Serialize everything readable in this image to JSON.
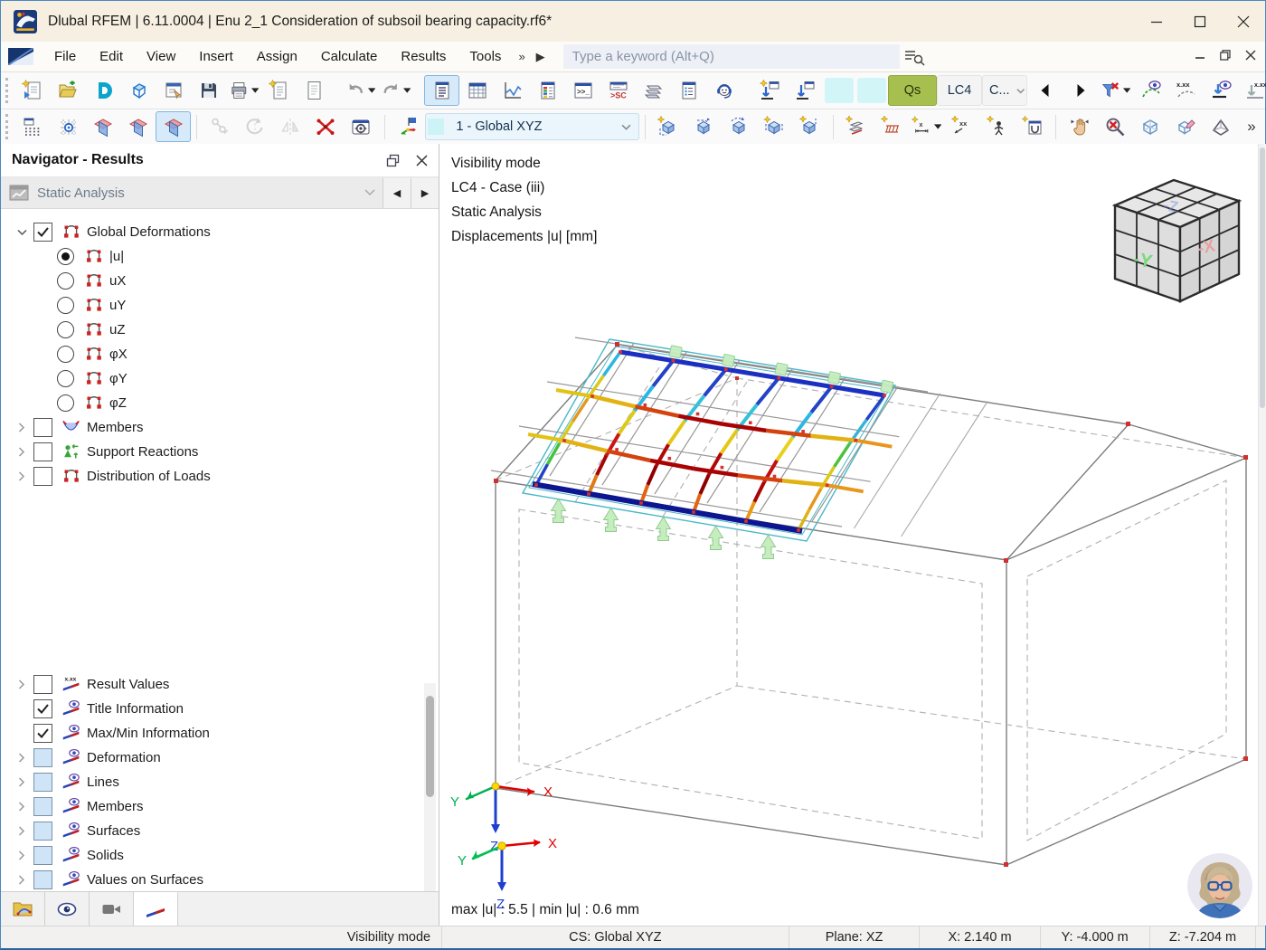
{
  "window": {
    "title": "Dlubal RFEM | 6.11.0004 | Enu 2_1 Consideration of subsoil bearing capacity.rf6*"
  },
  "menubar": {
    "items": [
      "File",
      "Edit",
      "View",
      "Insert",
      "Assign",
      "Calculate",
      "Results",
      "Tools"
    ],
    "overflow_chevrons": "»",
    "overflow_arrow": "▶",
    "search": {
      "placeholder": "Type a keyword (Alt+Q)"
    }
  },
  "toolbar_main": [
    {
      "type": "handle"
    },
    {
      "name": "new-model-button",
      "icon": "page-new"
    },
    {
      "name": "open-model-button",
      "icon": "folder-open"
    },
    {
      "name": "dlubal-center-button",
      "icon": "letter-d"
    },
    {
      "name": "model-3d-button",
      "icon": "cube-3d"
    },
    {
      "name": "edit-model-data-button",
      "icon": "form-edit"
    },
    {
      "name": "save-button",
      "icon": "save"
    },
    {
      "name": "print-button",
      "icon": "print",
      "caret": true
    },
    {
      "name": "new-printout-report-button",
      "icon": "page-star"
    },
    {
      "name": "printout-report-button",
      "icon": "page"
    },
    {
      "type": "sep"
    },
    {
      "name": "undo-button",
      "icon": "undo",
      "caret": true
    },
    {
      "name": "redo-button",
      "icon": "redo",
      "caret": true
    },
    {
      "type": "sep"
    },
    {
      "name": "navigator-toggle",
      "icon": "panel-navigator",
      "active": true
    },
    {
      "name": "tables-toggle",
      "icon": "table"
    },
    {
      "name": "result-diagrams-button",
      "icon": "diagram"
    },
    {
      "name": "color-panel-toggle",
      "icon": "panel-colors"
    },
    {
      "name": "console-button",
      "icon": "console"
    },
    {
      "name": "script-console-button",
      "icon": "console-sc"
    },
    {
      "name": "layers-button",
      "icon": "layers"
    },
    {
      "name": "lists-button",
      "icon": "panel-list"
    },
    {
      "name": "assistant-button",
      "icon": "assistant"
    },
    {
      "type": "sep"
    },
    {
      "name": "new-load-button",
      "icon": "load-new"
    },
    {
      "name": "show-loads-button",
      "icon": "load"
    },
    {
      "name": "load-swatch-1",
      "style": "swatch"
    },
    {
      "name": "load-swatch-2",
      "style": "swatch"
    },
    {
      "name": "load-type-button",
      "label": "Qs",
      "style": "qs"
    },
    {
      "name": "load-case-button",
      "label": "LC4",
      "style": "flat"
    },
    {
      "name": "case-combo",
      "label": "C...",
      "style": "flat",
      "caret": "chev"
    },
    {
      "name": "previous-case-button",
      "icon": "arrow-left"
    },
    {
      "name": "next-case-button",
      "icon": "arrow-right"
    },
    {
      "name": "filter-results-button",
      "icon": "filter-x",
      "caret": true
    },
    {
      "name": "show-results-toggle",
      "icon": "result-line-eye"
    },
    {
      "name": "result-values-toggle",
      "icon": "result-values"
    },
    {
      "name": "show-deformation-toggle",
      "icon": "result-arrow-eye"
    },
    {
      "name": "deformation-values-toggle",
      "icon": "result-arrow-values"
    },
    {
      "name": "render-solids-toggle",
      "icon": "solid-eye"
    },
    {
      "name": "toolbar-overflow-button",
      "label": "»",
      "style": "chev"
    }
  ],
  "toolbar_edit": [
    {
      "type": "handle"
    },
    {
      "name": "grid-button",
      "icon": "grid"
    },
    {
      "name": "snap-button",
      "icon": "snap"
    },
    {
      "name": "work-plane-xy-button",
      "icon": "plane"
    },
    {
      "name": "work-plane-xz-button",
      "icon": "plane"
    },
    {
      "name": "work-plane-yz-button",
      "icon": "plane",
      "active": true
    },
    {
      "type": "sep"
    },
    {
      "name": "select-objects-button",
      "icon": "move",
      "grayed": true
    },
    {
      "name": "rotate-objects-button",
      "icon": "rotate",
      "grayed": true
    },
    {
      "name": "mirror-objects-button",
      "icon": "mirror",
      "grayed": true
    },
    {
      "name": "delete-nodes-button",
      "icon": "node-x"
    },
    {
      "name": "display-settings-button",
      "icon": "settings-cam"
    },
    {
      "type": "sep"
    },
    {
      "name": "coordinate-system-button",
      "icon": "cs-axes"
    },
    {
      "name": "coordinate-system-combo",
      "label": "1 - Global XYZ",
      "style": "combo",
      "caret": "chev",
      "swatch": true
    },
    {
      "type": "sep"
    },
    {
      "name": "new-block-button",
      "icon": "block-new"
    },
    {
      "name": "extrude-block-button",
      "icon": "block-extrude"
    },
    {
      "name": "move-block-button",
      "icon": "block-move"
    },
    {
      "name": "copy-block-button",
      "icon": "block-copy"
    },
    {
      "name": "modify-block-button",
      "icon": "block-modify"
    },
    {
      "type": "sep"
    },
    {
      "name": "new-dimension-button",
      "icon": "dim-layers"
    },
    {
      "name": "new-grid-dimension-button",
      "icon": "dim-grid"
    },
    {
      "name": "dimension-x-button",
      "icon": "dim-x",
      "caret": true
    },
    {
      "name": "dimension-xx-button",
      "icon": "dim-xx"
    },
    {
      "name": "annotation-button",
      "icon": "dim-person"
    },
    {
      "name": "clipping-window-button",
      "icon": "dim-clip"
    },
    {
      "type": "sep"
    },
    {
      "name": "pan-view-button",
      "icon": "hand-move"
    },
    {
      "name": "zoom-cancel-button",
      "icon": "zoom-x"
    },
    {
      "name": "wireframe-view-button",
      "icon": "cube-wire"
    },
    {
      "name": "edit-view-button",
      "icon": "cube-edit"
    },
    {
      "name": "isometric-view-button",
      "icon": "cube-iso"
    },
    {
      "name": "toolbar2-overflow-button",
      "label": "»",
      "style": "chev"
    }
  ],
  "navigator": {
    "title": "Navigator - Results",
    "selector": {
      "label": "Static Analysis"
    },
    "results_tree": [
      {
        "name": "global-deformations",
        "label": "Global Deformations",
        "chevron": "expanded",
        "state": "checked",
        "icon": "surface-result",
        "indent": 0
      },
      {
        "name": "u-abs",
        "label": "|u|",
        "state": "radio-on",
        "icon": "surface-result",
        "indent": 1
      },
      {
        "name": "u-x",
        "label": "uX",
        "state": "radio-off",
        "icon": "surface-result",
        "indent": 1
      },
      {
        "name": "u-y",
        "label": "uY",
        "state": "radio-off",
        "icon": "surface-result",
        "indent": 1
      },
      {
        "name": "u-z",
        "label": "uZ",
        "state": "radio-off",
        "icon": "surface-result",
        "indent": 1
      },
      {
        "name": "phi-x",
        "label": "φX",
        "state": "radio-off",
        "icon": "surface-result",
        "indent": 1
      },
      {
        "name": "phi-y",
        "label": "φY",
        "state": "radio-off",
        "icon": "surface-result",
        "indent": 1
      },
      {
        "name": "phi-z",
        "label": "φZ",
        "state": "radio-off",
        "icon": "surface-result",
        "indent": 1
      },
      {
        "name": "members",
        "label": "Members",
        "chevron": "collapsed",
        "state": "unchecked",
        "icon": "member-result",
        "indent": 0
      },
      {
        "name": "support-reactions",
        "label": "Support Reactions",
        "chevron": "collapsed",
        "state": "unchecked",
        "icon": "support",
        "indent": 0
      },
      {
        "name": "distribution-of-loads",
        "label": "Distribution of Loads",
        "chevron": "collapsed",
        "state": "unchecked",
        "icon": "surface-result",
        "indent": 0
      }
    ],
    "display_tree": [
      {
        "name": "result-values",
        "label": "Result Values",
        "chevron": "collapsed",
        "state": "unchecked",
        "icon": "xxx-slope",
        "indent": 0
      },
      {
        "name": "title-information",
        "label": "Title Information",
        "state": "checked",
        "icon": "eye-slope",
        "indent": 0
      },
      {
        "name": "maxmin-information",
        "label": "Max/Min Information",
        "state": "checked",
        "icon": "eye-slope",
        "indent": 0
      },
      {
        "name": "deformation",
        "label": "Deformation",
        "chevron": "collapsed",
        "state": "partial",
        "icon": "eye-slope",
        "indent": 0
      },
      {
        "name": "lines",
        "label": "Lines",
        "chevron": "collapsed",
        "state": "partial",
        "icon": "eye-slope",
        "indent": 0
      },
      {
        "name": "members-display",
        "label": "Members",
        "chevron": "collapsed",
        "state": "partial",
        "icon": "eye-slope",
        "indent": 0
      },
      {
        "name": "surfaces",
        "label": "Surfaces",
        "chevron": "collapsed",
        "state": "partial",
        "icon": "eye-slope",
        "indent": 0
      },
      {
        "name": "solids",
        "label": "Solids",
        "chevron": "collapsed",
        "state": "partial",
        "icon": "eye-slope",
        "indent": 0
      },
      {
        "name": "values-on-surfaces",
        "label": "Values on Surfaces",
        "chevron": "collapsed",
        "state": "partial",
        "icon": "eye-slope",
        "indent": 0
      }
    ],
    "tabs": [
      {
        "name": "tab-data",
        "icon": "tab-data",
        "active": false
      },
      {
        "name": "tab-views",
        "icon": "tab-views",
        "active": false
      },
      {
        "name": "tab-camera",
        "icon": "tab-camera",
        "active": false
      },
      {
        "name": "tab-results",
        "icon": "tab-results",
        "active": true
      }
    ]
  },
  "viewport": {
    "info_lines": [
      "Visibility mode",
      "LC4 - Case (iii)",
      "Static Analysis",
      "Displacements |u| [mm]"
    ],
    "result_summary": "max |u| : 5.5 | min |u| : 0.6 mm",
    "cube": {
      "left": "-Y",
      "right": "-X",
      "top": "-Z"
    },
    "axes": {
      "x": "X",
      "y": "Y",
      "z": "Z"
    }
  },
  "statusbar": {
    "items": [
      {
        "name": "status-mode",
        "label": "Visibility mode"
      },
      {
        "name": "status-cs",
        "label": "CS: Global XYZ"
      },
      {
        "name": "status-plane",
        "label": "Plane: XZ"
      },
      {
        "name": "status-x",
        "label": "X: 2.140 m"
      },
      {
        "name": "status-y",
        "label": "Y: -4.000 m"
      },
      {
        "name": "status-z",
        "label": "Z: -7.204 m"
      }
    ]
  }
}
